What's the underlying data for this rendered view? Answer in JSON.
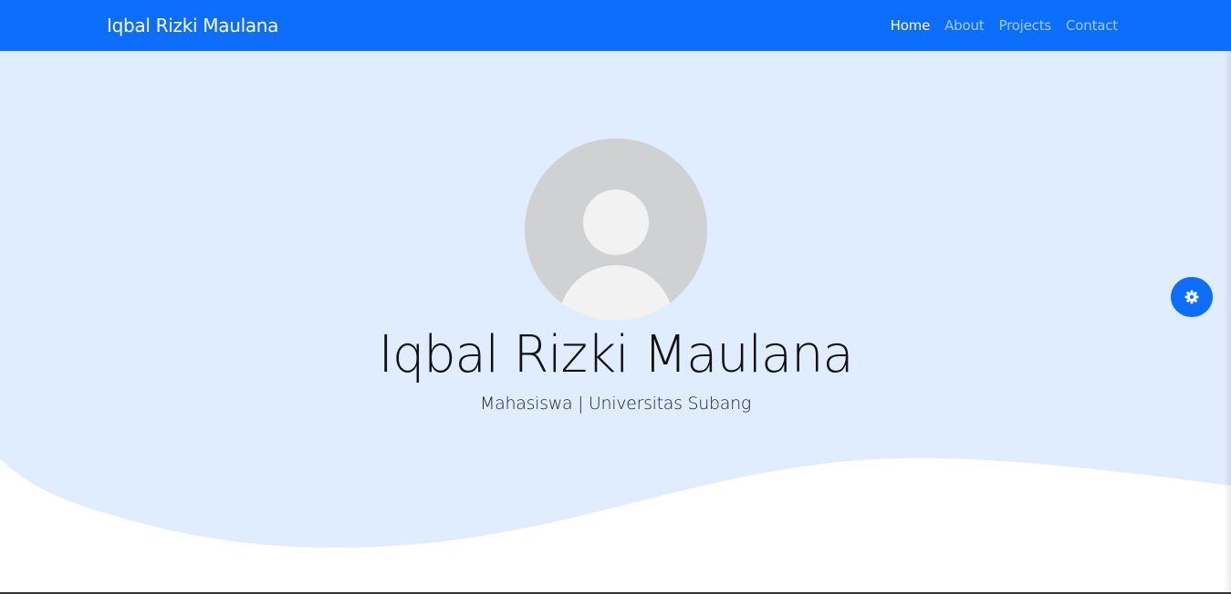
{
  "navbar": {
    "brand": "Iqbal Rizki Maulana",
    "links": [
      {
        "label": "Home",
        "active": true
      },
      {
        "label": "About",
        "active": false
      },
      {
        "label": "Projects",
        "active": false
      },
      {
        "label": "Contact",
        "active": false
      }
    ]
  },
  "hero": {
    "title": "Iqbal Rizki Maulana",
    "subtitle": "Mahasiswa | Universitas Subang",
    "avatar_icon": "user-placeholder-icon"
  },
  "settings": {
    "icon": "gear-icon"
  },
  "colors": {
    "primary": "#0d6efd",
    "hero_background": "#e0ecff",
    "avatar_background": "#d0d1d3",
    "avatar_figure": "#f2f2f2"
  }
}
